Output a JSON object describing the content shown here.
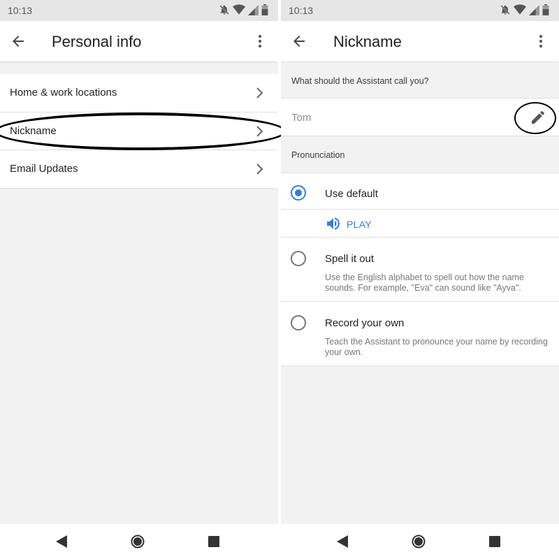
{
  "status": {
    "time": "10:13"
  },
  "left": {
    "title": "Personal info",
    "items": [
      {
        "label": "Home & work locations"
      },
      {
        "label": "Nickname"
      },
      {
        "label": "Email Updates"
      }
    ]
  },
  "right": {
    "title": "Nickname",
    "question": "What should the Assistant call you?",
    "name_value": "Tom",
    "pronunciation_header": "Pronunciation",
    "options": [
      {
        "title": "Use default",
        "selected": true
      },
      {
        "title": "Spell it out",
        "description": "Use the English alphabet to spell out how the name sounds. For example, \"Eva\" can sound like \"Ayva\".",
        "selected": false
      },
      {
        "title": "Record your own",
        "description": "Teach the Assistant to pronounce your name by recording your own.",
        "selected": false
      }
    ],
    "play_label": "PLAY"
  },
  "colors": {
    "accent": "#2f7ee6",
    "background": "#f2f2f2",
    "statusbar": "#e6e6e6"
  },
  "icons": [
    "back-arrow-icon",
    "overflow-menu-icon",
    "chevron-right-icon",
    "pencil-icon",
    "speaker-icon",
    "radio-icon",
    "mute-icon",
    "wifi-icon",
    "signal-icon",
    "battery-icon",
    "nav-back-icon",
    "nav-home-icon",
    "nav-recents-icon"
  ]
}
